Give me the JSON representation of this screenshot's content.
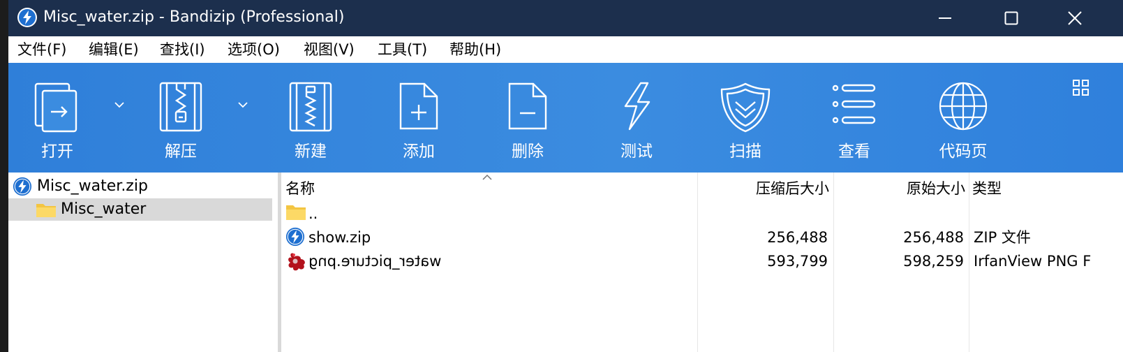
{
  "window": {
    "title": "Misc_water.zip - Bandizip (Professional)"
  },
  "menu": [
    {
      "label": "文件(F)"
    },
    {
      "label": "编辑(E)"
    },
    {
      "label": "查找(I)"
    },
    {
      "label": "选项(O)"
    },
    {
      "label": "视图(V)"
    },
    {
      "label": "工具(T)"
    },
    {
      "label": "帮助(H)"
    }
  ],
  "toolbar": [
    {
      "label": "打开",
      "icon": "open-icon"
    },
    {
      "label": "解压",
      "icon": "extract-icon"
    },
    {
      "label": "新建",
      "icon": "new-archive-icon"
    },
    {
      "label": "添加",
      "icon": "add-file-icon"
    },
    {
      "label": "删除",
      "icon": "delete-file-icon"
    },
    {
      "label": "测试",
      "icon": "test-lightning-icon"
    },
    {
      "label": "扫描",
      "icon": "scan-shield-icon"
    },
    {
      "label": "查看",
      "icon": "view-list-icon"
    },
    {
      "label": "代码页",
      "icon": "codepage-globe-icon"
    }
  ],
  "tree": [
    {
      "label": "Misc_water.zip",
      "icon": "bandizip-archive-icon",
      "selected": false
    },
    {
      "label": "Misc_water",
      "icon": "folder-icon",
      "selected": true
    }
  ],
  "columns": {
    "name": "名称",
    "packed": "压缩后大小",
    "size": "原始大小",
    "type": "类型"
  },
  "files": [
    {
      "name": "..",
      "icon": "folder-icon",
      "packed": "",
      "size": "",
      "type": ""
    },
    {
      "name": "show.zip",
      "icon": "bandizip-archive-icon",
      "packed": "256,488",
      "size": "256,488",
      "type": "ZIP 文件"
    },
    {
      "name": "water_picture.png",
      "icon": "irfanview-icon",
      "packed": "593,799",
      "size": "598,259",
      "type": "IrfanView PNG F"
    }
  ],
  "colors": {
    "titlebar": "#1c2f4d",
    "toolbar": "#3b8ce0",
    "selection": "#d9d9d9",
    "bandizip_blue": "#1e6fd0"
  }
}
